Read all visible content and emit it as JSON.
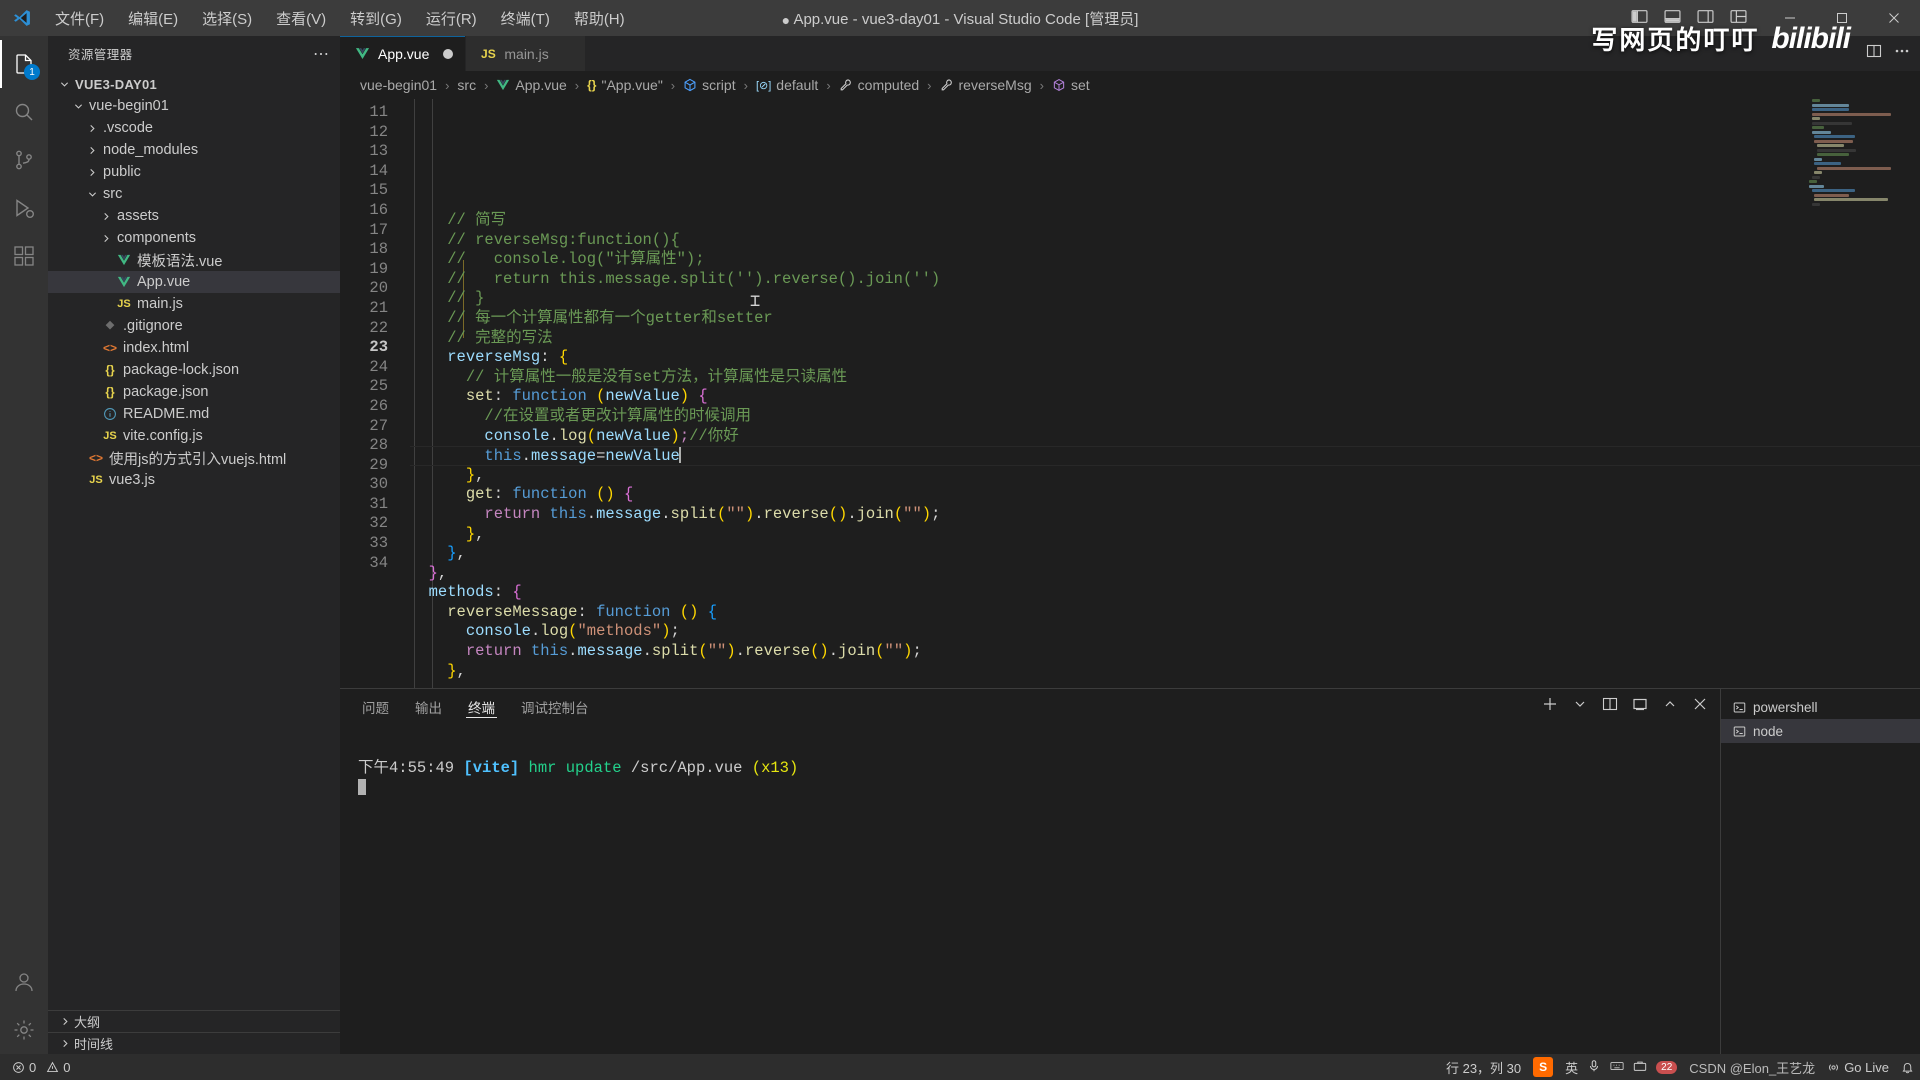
{
  "window": {
    "title": "App.vue - vue3-day01 - Visual Studio Code [管理员]",
    "dirty_dot": "●",
    "menu": [
      {
        "label": "文件(F)",
        "name": "menu-file"
      },
      {
        "label": "编辑(E)",
        "name": "menu-edit"
      },
      {
        "label": "选择(S)",
        "name": "menu-selection"
      },
      {
        "label": "查看(V)",
        "name": "menu-view"
      },
      {
        "label": "转到(G)",
        "name": "menu-go"
      },
      {
        "label": "运行(R)",
        "name": "menu-run"
      },
      {
        "label": "终端(T)",
        "name": "menu-terminal"
      },
      {
        "label": "帮助(H)",
        "name": "menu-help"
      }
    ],
    "controls": {
      "minimize": "—",
      "maximize": "▢",
      "close": "✕"
    }
  },
  "watermark": {
    "text": "写网页的叮叮",
    "logo": "bilibili"
  },
  "activitybar": {
    "items": [
      {
        "name": "explorer",
        "icon": "files-icon",
        "badge": "1",
        "active": true
      },
      {
        "name": "search",
        "icon": "search-icon",
        "badge": "",
        "active": false
      },
      {
        "name": "source-control",
        "icon": "source-control-icon",
        "badge": "",
        "active": false
      },
      {
        "name": "run-debug",
        "icon": "run-debug-icon",
        "badge": "",
        "active": false
      },
      {
        "name": "extensions",
        "icon": "extensions-icon",
        "badge": "",
        "active": false
      }
    ],
    "bottom": [
      {
        "name": "accounts",
        "icon": "account-icon"
      },
      {
        "name": "settings",
        "icon": "gear-icon"
      }
    ]
  },
  "sidebar": {
    "title": "资源管理器",
    "more_label": "⋯",
    "root": "VUE3-DAY01",
    "tree": [
      {
        "label": "VUE3-DAY01",
        "indent": 0,
        "kind": "root",
        "expanded": true,
        "icon": "",
        "selected": false
      },
      {
        "label": "vue-begin01",
        "indent": 1,
        "kind": "folder",
        "expanded": true,
        "icon": "",
        "selected": false
      },
      {
        "label": ".vscode",
        "indent": 2,
        "kind": "folder",
        "expanded": false,
        "icon": "",
        "selected": false
      },
      {
        "label": "node_modules",
        "indent": 2,
        "kind": "folder",
        "expanded": false,
        "icon": "",
        "selected": false
      },
      {
        "label": "public",
        "indent": 2,
        "kind": "folder",
        "expanded": false,
        "icon": "",
        "selected": false
      },
      {
        "label": "src",
        "indent": 2,
        "kind": "folder",
        "expanded": true,
        "icon": "",
        "selected": false
      },
      {
        "label": "assets",
        "indent": 3,
        "kind": "folder",
        "expanded": false,
        "icon": "",
        "selected": false
      },
      {
        "label": "components",
        "indent": 3,
        "kind": "folder",
        "expanded": false,
        "icon": "",
        "selected": false
      },
      {
        "label": "模板语法.vue",
        "indent": 3,
        "kind": "file",
        "icon": "vue-icon",
        "selected": false
      },
      {
        "label": "App.vue",
        "indent": 3,
        "kind": "file",
        "icon": "vue-icon",
        "selected": true
      },
      {
        "label": "main.js",
        "indent": 3,
        "kind": "file",
        "icon": "js-icon",
        "selected": false
      },
      {
        "label": ".gitignore",
        "indent": 2,
        "kind": "file",
        "icon": "git-icon",
        "selected": false
      },
      {
        "label": "index.html",
        "indent": 2,
        "kind": "file",
        "icon": "html-icon",
        "selected": false
      },
      {
        "label": "package-lock.json",
        "indent": 2,
        "kind": "file",
        "icon": "json-icon",
        "selected": false
      },
      {
        "label": "package.json",
        "indent": 2,
        "kind": "file",
        "icon": "json-icon",
        "selected": false
      },
      {
        "label": "README.md",
        "indent": 2,
        "kind": "file",
        "icon": "markdown-icon",
        "selected": false
      },
      {
        "label": "vite.config.js",
        "indent": 2,
        "kind": "file",
        "icon": "js-icon",
        "selected": false
      },
      {
        "label": "使用js的方式引入vuejs.html",
        "indent": 1,
        "kind": "file",
        "icon": "html-icon",
        "selected": false
      },
      {
        "label": "vue3.js",
        "indent": 1,
        "kind": "file",
        "icon": "js-icon",
        "selected": false
      }
    ],
    "sections": [
      {
        "label": "大纲",
        "name": "outline-section"
      },
      {
        "label": "时间线",
        "name": "timeline-section"
      }
    ]
  },
  "tabs": [
    {
      "label": "App.vue",
      "icon": "vue-icon",
      "active": true,
      "dirty": true
    },
    {
      "label": "main.js",
      "icon": "js-icon",
      "active": false,
      "dirty": false
    }
  ],
  "breadcrumb": [
    {
      "label": "vue-begin01",
      "icon": ""
    },
    {
      "label": "src",
      "icon": ""
    },
    {
      "label": "App.vue",
      "icon": "vue-icon"
    },
    {
      "label": "\"App.vue\"",
      "icon": "json-icon"
    },
    {
      "label": "script",
      "icon": "object-icon"
    },
    {
      "label": "default",
      "icon": "key-icon"
    },
    {
      "label": "computed",
      "icon": "property-icon"
    },
    {
      "label": "reverseMsg",
      "icon": "property-icon"
    },
    {
      "label": "set",
      "icon": "method-icon"
    }
  ],
  "editor": {
    "first_line": 11,
    "current_line": 23,
    "lines": [
      {
        "n": 11,
        "segs": [
          {
            "t": "    // 简写",
            "c": "c-com"
          }
        ]
      },
      {
        "n": 12,
        "segs": [
          {
            "t": "    // reverseMsg:function(){",
            "c": "c-com"
          }
        ]
      },
      {
        "n": 13,
        "segs": [
          {
            "t": "    //   console.log(\"计算属性\");",
            "c": "c-com"
          }
        ]
      },
      {
        "n": 14,
        "segs": [
          {
            "t": "    //   return this.message.split('').reverse().join('')",
            "c": "c-com"
          }
        ]
      },
      {
        "n": 15,
        "segs": [
          {
            "t": "    // }",
            "c": "c-com"
          }
        ]
      },
      {
        "n": 16,
        "segs": [
          {
            "t": "    // 每一个计算属性都有一个getter和setter",
            "c": "c-com"
          }
        ]
      },
      {
        "n": 17,
        "segs": [
          {
            "t": "    // 完整的写法",
            "c": "c-com"
          }
        ]
      },
      {
        "n": 18,
        "segs": [
          {
            "t": "    ",
            "c": ""
          },
          {
            "t": "reverseMsg",
            "c": "c-var"
          },
          {
            "t": ": ",
            "c": "c-op"
          },
          {
            "t": "{",
            "c": "c-par"
          }
        ]
      },
      {
        "n": 19,
        "segs": [
          {
            "t": "      ",
            "c": ""
          },
          {
            "t": "// 计算属性一般是没有set方法，计算属性是只读属性",
            "c": "c-com"
          }
        ]
      },
      {
        "n": 20,
        "segs": [
          {
            "t": "      ",
            "c": ""
          },
          {
            "t": "set",
            "c": "c-fn"
          },
          {
            "t": ": ",
            "c": "c-op"
          },
          {
            "t": "function",
            "c": "c-kw"
          },
          {
            "t": " ",
            "c": ""
          },
          {
            "t": "(",
            "c": "c-par"
          },
          {
            "t": "newValue",
            "c": "c-var"
          },
          {
            "t": ")",
            "c": "c-par"
          },
          {
            "t": " ",
            "c": ""
          },
          {
            "t": "{",
            "c": "c-par2"
          }
        ]
      },
      {
        "n": 21,
        "segs": [
          {
            "t": "        ",
            "c": ""
          },
          {
            "t": "//在设置或者更改计算属性的时候调用",
            "c": "c-com"
          }
        ]
      },
      {
        "n": 22,
        "segs": [
          {
            "t": "        ",
            "c": ""
          },
          {
            "t": "console",
            "c": "c-var"
          },
          {
            "t": ".",
            "c": "c-op"
          },
          {
            "t": "log",
            "c": "c-fn"
          },
          {
            "t": "(",
            "c": "c-par"
          },
          {
            "t": "newValue",
            "c": "c-var"
          },
          {
            "t": ")",
            "c": "c-par"
          },
          {
            "t": ";",
            "c": "c-ret"
          },
          {
            "t": "//你好",
            "c": "c-com"
          }
        ]
      },
      {
        "n": 23,
        "segs": [
          {
            "t": "        ",
            "c": ""
          },
          {
            "t": "this",
            "c": "c-this"
          },
          {
            "t": ".",
            "c": "c-op"
          },
          {
            "t": "message",
            "c": "c-var"
          },
          {
            "t": "=",
            "c": "c-op"
          },
          {
            "t": "newValue",
            "c": "c-var"
          }
        ],
        "cursor": true
      },
      {
        "n": 24,
        "segs": [
          {
            "t": "      ",
            "c": ""
          },
          {
            "t": "}",
            "c": "c-par"
          },
          {
            "t": ",",
            "c": "c-op"
          }
        ]
      },
      {
        "n": 25,
        "segs": [
          {
            "t": "      ",
            "c": ""
          },
          {
            "t": "get",
            "c": "c-fn"
          },
          {
            "t": ": ",
            "c": "c-op"
          },
          {
            "t": "function",
            "c": "c-kw"
          },
          {
            "t": " ",
            "c": ""
          },
          {
            "t": "()",
            "c": "c-par"
          },
          {
            "t": " ",
            "c": ""
          },
          {
            "t": "{",
            "c": "c-par2"
          }
        ]
      },
      {
        "n": 26,
        "segs": [
          {
            "t": "        ",
            "c": ""
          },
          {
            "t": "return",
            "c": "c-ret"
          },
          {
            "t": " ",
            "c": ""
          },
          {
            "t": "this",
            "c": "c-this"
          },
          {
            "t": ".",
            "c": "c-op"
          },
          {
            "t": "message",
            "c": "c-var"
          },
          {
            "t": ".",
            "c": "c-op"
          },
          {
            "t": "split",
            "c": "c-fn"
          },
          {
            "t": "(",
            "c": "c-par"
          },
          {
            "t": "\"\"",
            "c": "c-str"
          },
          {
            "t": ")",
            "c": "c-par"
          },
          {
            "t": ".",
            "c": "c-op"
          },
          {
            "t": "reverse",
            "c": "c-fn"
          },
          {
            "t": "()",
            "c": "c-par"
          },
          {
            "t": ".",
            "c": "c-op"
          },
          {
            "t": "join",
            "c": "c-fn"
          },
          {
            "t": "(",
            "c": "c-par"
          },
          {
            "t": "\"\"",
            "c": "c-str"
          },
          {
            "t": ")",
            "c": "c-par"
          },
          {
            "t": ";",
            "c": "c-op"
          }
        ]
      },
      {
        "n": 27,
        "segs": [
          {
            "t": "      ",
            "c": ""
          },
          {
            "t": "}",
            "c": "c-par"
          },
          {
            "t": ",",
            "c": "c-op"
          }
        ]
      },
      {
        "n": 28,
        "segs": [
          {
            "t": "    ",
            "c": ""
          },
          {
            "t": "}",
            "c": "c-par3"
          },
          {
            "t": ",",
            "c": "c-op"
          }
        ]
      },
      {
        "n": 29,
        "segs": [
          {
            "t": "  ",
            "c": ""
          },
          {
            "t": "}",
            "c": "c-par2"
          },
          {
            "t": ",",
            "c": "c-op"
          }
        ]
      },
      {
        "n": 30,
        "segs": [
          {
            "t": "  ",
            "c": ""
          },
          {
            "t": "methods",
            "c": "c-var"
          },
          {
            "t": ": ",
            "c": "c-op"
          },
          {
            "t": "{",
            "c": "c-par2"
          }
        ]
      },
      {
        "n": 31,
        "segs": [
          {
            "t": "    ",
            "c": ""
          },
          {
            "t": "reverseMessage",
            "c": "c-fn"
          },
          {
            "t": ": ",
            "c": "c-op"
          },
          {
            "t": "function",
            "c": "c-kw"
          },
          {
            "t": " ",
            "c": ""
          },
          {
            "t": "()",
            "c": "c-par"
          },
          {
            "t": " ",
            "c": ""
          },
          {
            "t": "{",
            "c": "c-par3"
          }
        ]
      },
      {
        "n": 32,
        "segs": [
          {
            "t": "      ",
            "c": ""
          },
          {
            "t": "console",
            "c": "c-var"
          },
          {
            "t": ".",
            "c": "c-op"
          },
          {
            "t": "log",
            "c": "c-fn"
          },
          {
            "t": "(",
            "c": "c-par"
          },
          {
            "t": "\"methods\"",
            "c": "c-str"
          },
          {
            "t": ")",
            "c": "c-par"
          },
          {
            "t": ";",
            "c": "c-op"
          }
        ]
      },
      {
        "n": 33,
        "segs": [
          {
            "t": "      ",
            "c": ""
          },
          {
            "t": "return",
            "c": "c-ret"
          },
          {
            "t": " ",
            "c": ""
          },
          {
            "t": "this",
            "c": "c-this"
          },
          {
            "t": ".",
            "c": "c-op"
          },
          {
            "t": "message",
            "c": "c-var"
          },
          {
            "t": ".",
            "c": "c-op"
          },
          {
            "t": "split",
            "c": "c-fn"
          },
          {
            "t": "(",
            "c": "c-par"
          },
          {
            "t": "\"\"",
            "c": "c-str"
          },
          {
            "t": ")",
            "c": "c-par"
          },
          {
            "t": ".",
            "c": "c-op"
          },
          {
            "t": "reverse",
            "c": "c-fn"
          },
          {
            "t": "()",
            "c": "c-par"
          },
          {
            "t": ".",
            "c": "c-op"
          },
          {
            "t": "join",
            "c": "c-fn"
          },
          {
            "t": "(",
            "c": "c-par"
          },
          {
            "t": "\"\"",
            "c": "c-str"
          },
          {
            "t": ")",
            "c": "c-par"
          },
          {
            "t": ";",
            "c": "c-op"
          }
        ]
      },
      {
        "n": 34,
        "segs": [
          {
            "t": "    ",
            "c": ""
          },
          {
            "t": "}",
            "c": "c-par"
          },
          {
            "t": ",",
            "c": "c-op"
          }
        ]
      }
    ]
  },
  "panel": {
    "tabs": [
      {
        "label": "问题",
        "active": false,
        "name": "panel-tab-problems"
      },
      {
        "label": "输出",
        "active": false,
        "name": "panel-tab-output"
      },
      {
        "label": "终端",
        "active": true,
        "name": "panel-tab-terminal"
      },
      {
        "label": "调试控制台",
        "active": false,
        "name": "panel-tab-debug-console"
      }
    ],
    "terminal_line": {
      "time": "下午4:55:49 ",
      "tag": "[vite]",
      "action": " hmr update ",
      "path": "/src/App.vue ",
      "count": "(x13)"
    },
    "instances": [
      {
        "label": "powershell",
        "active": false
      },
      {
        "label": "node",
        "active": true
      }
    ],
    "actions": {
      "new": "+",
      "split": "⌄",
      "close": "✕"
    }
  },
  "statusbar": {
    "errors": "0",
    "warnings": "0",
    "position": "行 23，列 30",
    "ime_lang": "英",
    "ime_badge": "22",
    "watermark": "CSDN @Elon_王艺龙",
    "go_live": "Go Live",
    "sogou": "S"
  },
  "colors": {
    "accent": "#007acc",
    "titlebar_bg": "#3c3c3c",
    "sidebar_bg": "#252526",
    "editor_bg": "#1e1e1e",
    "activitybar_bg": "#333333",
    "statusbar_bg": "#2d2d2d",
    "vue_green": "#41b883",
    "js_yellow": "#e8d44d"
  }
}
